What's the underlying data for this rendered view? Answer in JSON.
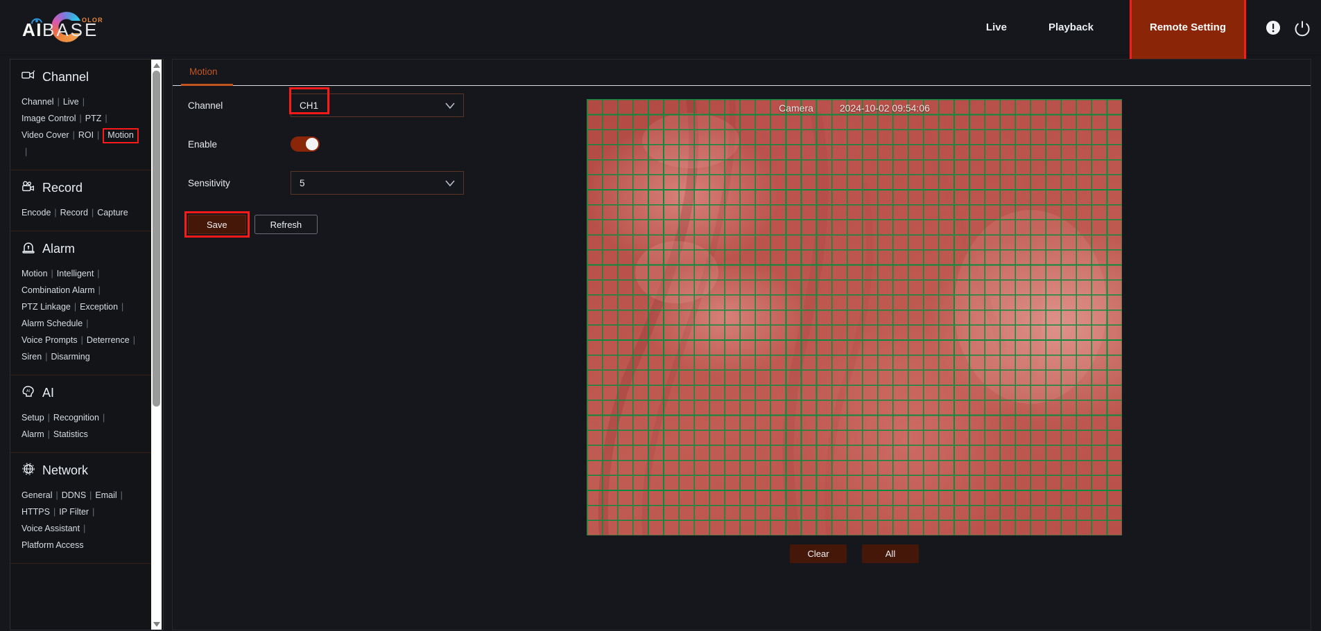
{
  "header": {
    "logo": {
      "ai": "AI",
      "base": "BASE",
      "olor": "OLOR"
    },
    "nav": [
      {
        "label": "Live",
        "active": false
      },
      {
        "label": "Playback",
        "active": false
      },
      {
        "label": "Remote Setting",
        "active": true
      }
    ],
    "icons": [
      {
        "name": "info-icon"
      },
      {
        "name": "power-icon"
      }
    ]
  },
  "sidebar": {
    "groups": [
      {
        "title": "Channel",
        "icon": "camera-icon",
        "rows": [
          [
            {
              "label": "Channel"
            },
            {
              "label": "Live"
            }
          ],
          [
            {
              "label": "Image Control"
            },
            {
              "label": "PTZ"
            }
          ],
          [
            {
              "label": "Video Cover"
            },
            {
              "label": "ROI"
            },
            {
              "label": "Motion",
              "active": true
            }
          ]
        ]
      },
      {
        "title": "Record",
        "icon": "video-camera-icon",
        "rows": [
          [
            {
              "label": "Encode"
            },
            {
              "label": "Record"
            },
            {
              "label": "Capture",
              "last": true
            }
          ]
        ]
      },
      {
        "title": "Alarm",
        "icon": "siren-icon",
        "rows": [
          [
            {
              "label": "Motion"
            },
            {
              "label": "Intelligent"
            }
          ],
          [
            {
              "label": "Combination Alarm"
            }
          ],
          [
            {
              "label": "PTZ Linkage"
            },
            {
              "label": "Exception"
            }
          ],
          [
            {
              "label": "Alarm Schedule"
            }
          ],
          [
            {
              "label": "Voice Prompts"
            },
            {
              "label": "Deterrence"
            }
          ],
          [
            {
              "label": "Siren"
            },
            {
              "label": "Disarming",
              "last": true
            }
          ]
        ]
      },
      {
        "title": "AI",
        "icon": "ai-head-icon",
        "rows": [
          [
            {
              "label": "Setup"
            },
            {
              "label": "Recognition"
            }
          ],
          [
            {
              "label": "Alarm"
            },
            {
              "label": "Statistics",
              "last": true
            }
          ]
        ]
      },
      {
        "title": "Network",
        "icon": "globe-icon",
        "rows": [
          [
            {
              "label": "General"
            },
            {
              "label": "DDNS"
            },
            {
              "label": "Email"
            }
          ],
          [
            {
              "label": "HTTPS"
            },
            {
              "label": "IP Filter"
            }
          ],
          [
            {
              "label": "Voice Assistant"
            }
          ],
          [
            {
              "label": "Platform Access",
              "last": true
            }
          ]
        ]
      }
    ],
    "separator": "|"
  },
  "main": {
    "tab": "Motion",
    "fields": {
      "channel_label": "Channel",
      "channel_value": "CH1",
      "enable_label": "Enable",
      "enable_on": true,
      "sensitivity_label": "Sensitivity",
      "sensitivity_value": "5"
    },
    "buttons": {
      "save": "Save",
      "refresh": "Refresh"
    },
    "video": {
      "camera_label": "Camera",
      "timestamp": "2024-10-02 09:54:06",
      "grid_cols": 35,
      "grid_rows": 29,
      "clear": "Clear",
      "all": "All"
    }
  },
  "colors": {
    "accent_orange": "#c4551f",
    "highlight_red": "#ff1a1a",
    "button_dark_red": "#451708",
    "nav_active_bg": "#8b2508",
    "grid_green": "#0c8a3e",
    "page_bg": "#15171c"
  }
}
